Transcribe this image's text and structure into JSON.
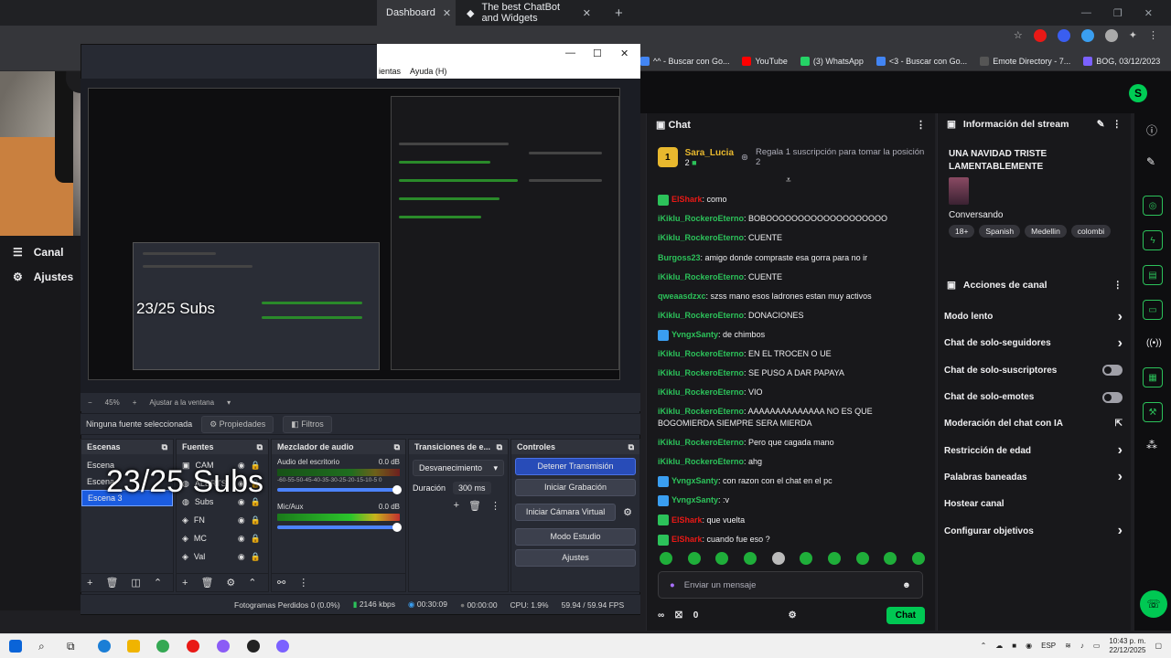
{
  "browser": {
    "tabs": [
      {
        "label": "Dashboard",
        "active": true
      },
      {
        "label": "The best ChatBot and Widgets",
        "active": false
      }
    ],
    "bookmarks": [
      {
        "label": "^^ - Buscar con Go...",
        "color": "#4285f4"
      },
      {
        "label": "YouTube",
        "color": "#ff0000"
      },
      {
        "label": "(3) WhatsApp",
        "color": "#25d366"
      },
      {
        "label": "<3 - Buscar con Go...",
        "color": "#4285f4"
      },
      {
        "label": "Emote Directory - 7...",
        "color": "#555555"
      },
      {
        "label": "BOG, 03/12/2023",
        "color": "#7b61ff"
      }
    ]
  },
  "left_menu": {
    "items": [
      {
        "label": "Canal",
        "icon": "list-icon"
      },
      {
        "label": "Ajustes",
        "icon": "gear-icon"
      }
    ]
  },
  "obs": {
    "menu": [
      "ientas",
      "Ayuda (H)"
    ],
    "zoom": "45%",
    "zoom_mode": "Ajustar a la ventana",
    "no_source": "Ninguna fuente seleccionada",
    "properties_label": "Propiedades",
    "filters_label": "Filtros",
    "overlay_text": "23/25 Subs",
    "docks": {
      "scenes_title": "Escenas",
      "sources_title": "Fuentes",
      "mixer_title": "Mezclador de audio",
      "transitions_title": "Transiciones de e...",
      "controls_title": "Controles"
    },
    "scenes": [
      "Escena",
      "Escena",
      "Escena 3"
    ],
    "sources": [
      "CAM",
      "ALERTS",
      "Subs",
      "FN",
      "MC",
      "Val"
    ],
    "mixer": [
      {
        "name": "Audio del escritorio",
        "db": "0.0 dB"
      },
      {
        "name": "Mic/Aux",
        "db": "0.0 dB"
      }
    ],
    "mixer_scale": "-60-55-50-45-40-35-30-25-20-15-10-5 0",
    "transition": "Desvanecimiento",
    "duration_label": "Duración",
    "duration_value": "300 ms",
    "controls": [
      {
        "label": "Detener Transmisión",
        "primary": true
      },
      {
        "label": "Iniciar Grabación",
        "primary": false
      },
      {
        "label": "Iniciar Cámara Virtual",
        "primary": false
      },
      {
        "label": "Modo Estudio",
        "primary": false
      },
      {
        "label": "Ajustes",
        "primary": false
      }
    ],
    "status": {
      "dropped": "Fotogramas Perdidos 0 (0.0%)",
      "bitrate": "2146 kbps",
      "stream_time": "00:30:09",
      "rec_time": "00:00:00",
      "cpu": "CPU: 1.9%",
      "fps": "59.94 / 59.94 FPS"
    }
  },
  "chat": {
    "title": "Chat",
    "pinned": {
      "rank": "1",
      "user": "Sara_Lucia",
      "count": "2",
      "text": "Regala 1 suscripción para tomar la posición 2"
    },
    "messages": [
      {
        "user": "ElShark",
        "color": "#e91916",
        "text": "como",
        "badge": "#2cc25a"
      },
      {
        "user": "iKiklu_RockeroEterno",
        "color": "#2cc25a",
        "text": "BOBOOOOOOOOOOOOOOOOOOO",
        "badge": ""
      },
      {
        "user": "iKiklu_RockeroEterno",
        "color": "#2cc25a",
        "text": "CUENTE",
        "badge": ""
      },
      {
        "user": "Burgoss23",
        "color": "#2cc25a",
        "text": "amigo donde compraste esa gorra para no ir",
        "badge": ""
      },
      {
        "user": "iKiklu_RockeroEterno",
        "color": "#2cc25a",
        "text": "CUENTE",
        "badge": ""
      },
      {
        "user": "qweaasdzxc",
        "color": "#2cc25a",
        "text": "szss mano esos ladrones estan muy activos",
        "badge": ""
      },
      {
        "user": "iKiklu_RockeroEterno",
        "color": "#2cc25a",
        "text": "DONACIONES",
        "badge": ""
      },
      {
        "user": "YvngxSanty",
        "color": "#2cc25a",
        "text": "de chimbos",
        "badge": "#3a9ef0"
      },
      {
        "user": "iKiklu_RockeroEterno",
        "color": "#2cc25a",
        "text": "EN EL TROCEN O UE",
        "badge": ""
      },
      {
        "user": "iKiklu_RockeroEterno",
        "color": "#2cc25a",
        "text": "SE PUSO A DAR PAPAYA",
        "badge": ""
      },
      {
        "user": "iKiklu_RockeroEterno",
        "color": "#2cc25a",
        "text": "VIO",
        "badge": ""
      },
      {
        "user": "iKiklu_RockeroEterno",
        "color": "#2cc25a",
        "text": "AAAAAAAAAAAAAA NO ES QUE BOGOMIERDA SIEMPRE SERA MIERDA",
        "badge": ""
      },
      {
        "user": "iKiklu_RockeroEterno",
        "color": "#2cc25a",
        "text": "Pero que cagada mano",
        "badge": ""
      },
      {
        "user": "iKiklu_RockeroEterno",
        "color": "#2cc25a",
        "text": "ahg",
        "badge": ""
      },
      {
        "user": "YvngxSanty",
        "color": "#2cc25a",
        "text": "con razon con el chat en el pc",
        "badge": "#3a9ef0"
      },
      {
        "user": "YvngxSanty",
        "color": "#2cc25a",
        "text": ":v",
        "badge": "#3a9ef0"
      },
      {
        "user": "ElShark",
        "color": "#e91916",
        "text": "que vuelta",
        "badge": "#2cc25a"
      },
      {
        "user": "ElShark",
        "color": "#e91916",
        "text": "cuando fue eso ?",
        "badge": "#2cc25a"
      }
    ],
    "input_placeholder": "Enviar un mensaje",
    "points": "0",
    "send_label": "Chat"
  },
  "stream_info": {
    "title": "Información del stream",
    "stream_title": "UNA NAVIDAD TRISTE LAMENTABLEMENTE",
    "category": "Conversando",
    "tags": [
      "18+",
      "Spanish",
      "Medellin",
      "colombi"
    ]
  },
  "channel_actions": {
    "title": "Acciones de canal",
    "items": [
      {
        "label": "Modo lento",
        "type": "chevron"
      },
      {
        "label": "Chat de solo-seguidores",
        "type": "chevron"
      },
      {
        "label": "Chat de solo-suscriptores",
        "type": "toggle"
      },
      {
        "label": "Chat de solo-emotes",
        "type": "toggle"
      },
      {
        "label": "Moderación del chat con IA",
        "type": "external"
      },
      {
        "label": "Restricción de edad",
        "type": "chevron"
      },
      {
        "label": "Palabras baneadas",
        "type": "chevron"
      },
      {
        "label": "Hostear canal",
        "type": "none"
      },
      {
        "label": "Configurar objetivos",
        "type": "chevron"
      }
    ]
  },
  "taskbar": {
    "lang": "ESP",
    "time": "10:43 p. m.",
    "date": "22/12/2025"
  }
}
